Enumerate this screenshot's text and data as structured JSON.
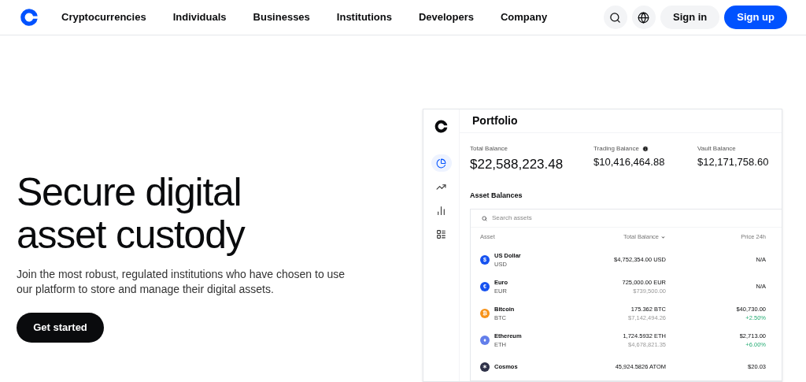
{
  "nav": {
    "items": [
      "Cryptocurrencies",
      "Individuals",
      "Businesses",
      "Institutions",
      "Developers",
      "Company"
    ],
    "sign_in": "Sign in",
    "sign_up": "Sign up"
  },
  "hero": {
    "title": "Secure digital asset custody",
    "subtitle": "Join the most robust, regulated institutions who have chosen to use our platform to store and manage their digital assets.",
    "button": "Get started"
  },
  "portfolio": {
    "title": "Portfolio",
    "sidebar": [
      {
        "kind": "pie",
        "selected": true
      },
      {
        "kind": "trend",
        "selected": false
      },
      {
        "kind": "bars",
        "selected": false
      },
      {
        "kind": "layout",
        "selected": false
      }
    ],
    "balances": [
      {
        "label": "Total Balance",
        "value": "$22,588,223.48",
        "info": false
      },
      {
        "label": "Trading Balance",
        "value": "$10,416,464.88",
        "info": true
      },
      {
        "label": "Vault Balance",
        "value": "$12,171,758.60",
        "info": false
      }
    ],
    "section": "Asset Balances",
    "search": {
      "placeholder": "Search assets"
    },
    "columns": [
      "Asset",
      "Total Balance",
      "Price 24h"
    ],
    "rows": [
      {
        "name": "US Dollar",
        "symbol": "USD",
        "glyph": "$",
        "color": "#1652f0",
        "amount": "$4,752,354.00 USD",
        "price": "N/A"
      },
      {
        "name": "Euro",
        "symbol": "EUR",
        "glyph": "€",
        "color": "#1652f0",
        "amount": "725,000.00 EUR",
        "fiat": "$739,500.00",
        "price": "N/A"
      },
      {
        "name": "Bitcoin",
        "symbol": "BTC",
        "glyph": "₿",
        "color": "#f7931a",
        "amount": "175.362 BTC",
        "fiat": "$7,142,494.26",
        "price": "$40,730.00",
        "change": "+2.50%"
      },
      {
        "name": "Ethereum",
        "symbol": "ETH",
        "glyph": "♦",
        "color": "#627eea",
        "amount": "1,724.5932 ETH",
        "fiat": "$4,678,821.35",
        "price": "$2,713.00",
        "change": "+6.00%"
      },
      {
        "name": "Cosmos",
        "glyph": "✶",
        "color": "#2e3148",
        "amount": "45,924.5826 ATOM",
        "price": "$20.03"
      }
    ]
  }
}
